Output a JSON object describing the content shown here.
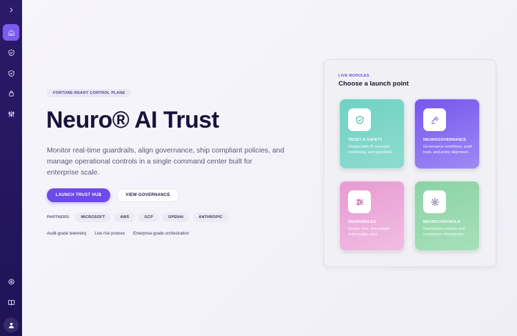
{
  "sidebar": {
    "items": [
      {
        "name": "expand",
        "icon": "chevron-right-icon"
      },
      {
        "name": "home",
        "icon": "home-icon",
        "active": true
      },
      {
        "name": "trust-safety",
        "icon": "shield-check-icon"
      },
      {
        "name": "governance",
        "icon": "shield-icon"
      },
      {
        "name": "security",
        "icon": "lock-icon"
      },
      {
        "name": "controls",
        "icon": "sliders-icon"
      },
      {
        "name": "settings",
        "icon": "gear-icon"
      },
      {
        "name": "docs",
        "icon": "book-icon"
      },
      {
        "name": "profile",
        "icon": "user-icon"
      }
    ]
  },
  "hero": {
    "chip": "FORTUNE-READY CONTROL PLANE",
    "title": "Neuro® AI Trust",
    "description": "Monitor real-time guardrails, align governance, ship compliant policies, and manage operational controls in a single command center built for enterprise scale.",
    "primary_cta": "LAUNCH TRUST HUB",
    "secondary_cta": "VIEW GOVERNANCE",
    "partners_label": "PARTNERS:",
    "partners": [
      "MICROSOFT",
      "AWS",
      "GCP",
      "OPENAI",
      "ANTHROPIC"
    ],
    "features": [
      "Audit-grade telemetry",
      "Live risk posture",
      "Enterprise-grade orchestration"
    ]
  },
  "modules": {
    "kicker": "LIVE MODULES",
    "title": "Choose a launch point",
    "cards": [
      {
        "title": "TRUST & SAFETY",
        "desc": "Responsible AI oversight, monitoring, and guardrails.",
        "icon": "shield-check-icon",
        "color": "#6fd2c3"
      },
      {
        "title": "NEUROGOVERNANCE",
        "desc": "Governance workflows, audit trails, and policy alignment.",
        "icon": "gavel-icon",
        "color": "#7656ee"
      },
      {
        "title": "NEURORULES",
        "desc": "Design, test, and publish enforceable rules.",
        "icon": "sliders-icon",
        "color": "#e79bd2"
      },
      {
        "title": "NEUROCONTROLS",
        "desc": "Operational controls and compliance checkpoints.",
        "icon": "gear-icon",
        "color": "#8ad3a4"
      }
    ]
  },
  "colors": {
    "sidebar": "#261862",
    "accent": "#6c4be8"
  }
}
